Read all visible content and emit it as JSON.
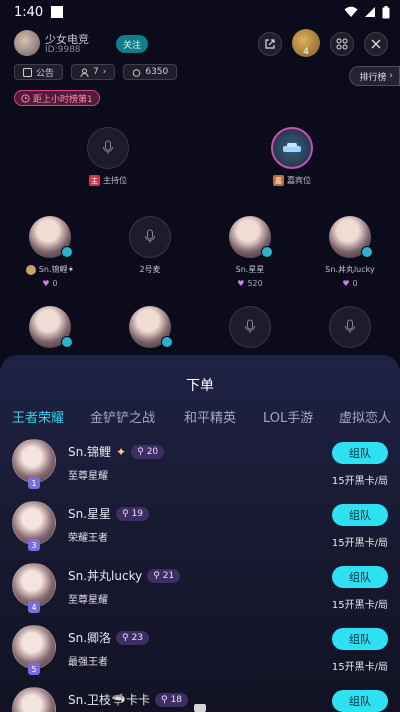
{
  "status_bar": {
    "time": "1:40"
  },
  "room": {
    "title": "少女电竞",
    "id_label": "ID:9988",
    "follow_label": "关注",
    "online_count": "4",
    "announcement_label": "公告",
    "people_label": "7",
    "hot_label": "6350",
    "rank_label": "排行榜",
    "countdown_label": "距上小时榜第1"
  },
  "seats": {
    "host_label": "主持位",
    "guest_label": "嘉宾位",
    "row2": [
      {
        "name": "Sn.锦鲤✦",
        "score": "0"
      },
      {
        "name": "2号麦",
        "score": ""
      },
      {
        "name": "Sn.星星",
        "score": "520"
      },
      {
        "name": "Sn.丼丸lucky",
        "score": "0"
      }
    ]
  },
  "sheet": {
    "title": "下单",
    "tabs": [
      "王者荣耀",
      "金铲铲之战",
      "和平精英",
      "LOL手游",
      "虚拟恋人"
    ],
    "active_tab_color": "#2fd6ea",
    "orders": [
      {
        "rank": "1",
        "name": "Sn.锦鲤",
        "level": "20",
        "game_rank": "至尊星耀",
        "button": "组队",
        "price": "15开黑卡/局"
      },
      {
        "rank": "3",
        "name": "Sn.星星",
        "level": "19",
        "game_rank": "荣耀王者",
        "button": "组队",
        "price": "15开黑卡/局"
      },
      {
        "rank": "4",
        "name": "Sn.丼丸lucky",
        "level": "21",
        "game_rank": "至尊星耀",
        "button": "组队",
        "price": "15开黑卡/局"
      },
      {
        "rank": "5",
        "name": "Sn.卿洛",
        "level": "23",
        "game_rank": "最强王者",
        "button": "组队",
        "price": "15开黑卡/局"
      },
      {
        "rank": "",
        "name": "Sn.卫枝🦈卡卡",
        "level": "18",
        "game_rank": "",
        "button": "组队",
        "price": ""
      }
    ]
  },
  "icons": {
    "mic": "microphone-icon",
    "share": "share-icon",
    "grid": "grid-icon",
    "close": "close-icon"
  }
}
